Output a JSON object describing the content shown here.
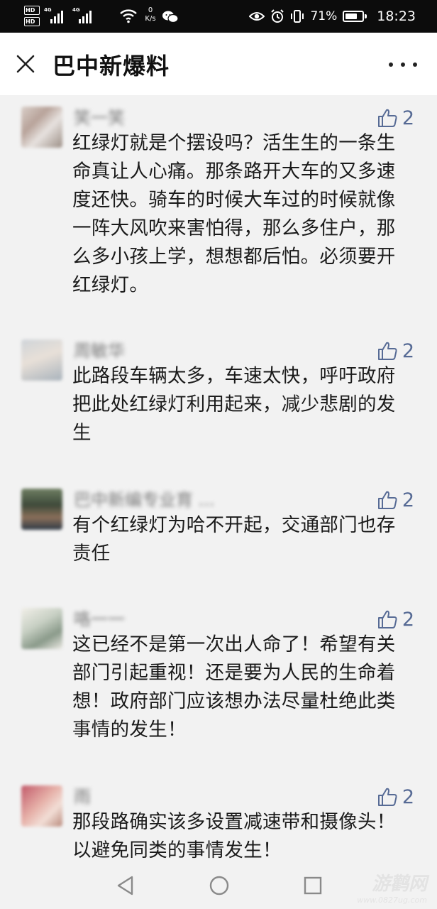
{
  "status_bar": {
    "hd_badges": [
      "HD",
      "HD"
    ],
    "signal_tags": [
      "4G",
      "4G"
    ],
    "net_speed_value": "0",
    "net_speed_unit": "K/s",
    "battery_percent": "71%",
    "battery_level": 0.71,
    "time": "18:23",
    "icons": [
      "hd-icon",
      "signal-icon",
      "wifi-icon",
      "wechat-icon",
      "eye-icon",
      "alarm-icon",
      "vibrate-icon",
      "battery-icon"
    ]
  },
  "header": {
    "title": "巴中新爆料",
    "icons": [
      "close-icon",
      "more-icon"
    ]
  },
  "comments": [
    {
      "name": "笑一笑",
      "likes": "2",
      "text": "红绿灯就是个摆设吗？活生生的一条生命真让人心痛。那条路开大车的又多速度还快。骑车的时候大车过的时候就像一阵大风吹来害怕得，那么多住户，那么多小孩上学，想想都后怕。必须要开红绿灯。"
    },
    {
      "name": "周敏华",
      "likes": "2",
      "text": "此路段车辆太多，车速太快，呼吁政府把此处红绿灯利用起来，减少悲剧的发生"
    },
    {
      "name": "巴中新编专业育 ...",
      "likes": "2",
      "text": "有个红绿灯为哈不开起，交通部门也存责任"
    },
    {
      "name": "咯一一",
      "likes": "2",
      "text": "这已经不是第一次出人命了！希望有关部门引起重视！还是要为人民的生命着想！政府部门应该想办法尽量杜绝此类事情的发生！"
    },
    {
      "name": "雨",
      "likes": "2",
      "text": "那段路确实该多设置减速带和摄像头！以避免同类的事情发生！"
    }
  ],
  "nav_bar": {
    "icons": [
      "back-icon",
      "home-icon",
      "recent-apps-icon"
    ]
  },
  "watermark": {
    "brand": "游鹳网",
    "url": "www.0827ug.com"
  },
  "colors": {
    "like": "#576b95",
    "background": "#f2f2f2",
    "header_bg": "#ffffff",
    "status_bg": "#0c0c0c"
  }
}
